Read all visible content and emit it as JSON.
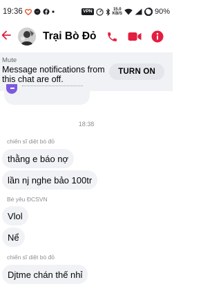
{
  "status_bar": {
    "time": "19:36",
    "vpn_label": "VPN",
    "speed_value": "15.0",
    "speed_unit": "KB/S",
    "battery_percent": "90%",
    "icons": [
      "heart-icon",
      "messenger-icon",
      "facebook-icon",
      "dot-icon",
      "vpn-icon",
      "speed-icon",
      "bluetooth-icon",
      "wifi-icon",
      "signal-icon",
      "battery-icon"
    ]
  },
  "header": {
    "contact_name": "Trại Bò Đỏ",
    "accent_color": "#e41e3f",
    "icons": [
      "back-arrow-icon",
      "phone-icon",
      "video-camera-icon",
      "info-icon"
    ]
  },
  "mute_banner": {
    "title": "Mute",
    "message": "Message notifications from this chat are off.",
    "button_label": "TURN ON"
  },
  "chat": {
    "timestamp": "18:38",
    "groups": [
      {
        "sender": "chiến sĩ diệt bò đỏ",
        "messages": [
          "thằng e báo nợ",
          "lần nj nghe bảo 100tr"
        ]
      },
      {
        "sender": "Bé yêu ĐCSVN",
        "messages": [
          "Vlol",
          "Nể"
        ]
      },
      {
        "sender": "chiến sĩ diệt bò đỏ",
        "messages": [
          "Djtme chán thế nhỉ"
        ]
      }
    ]
  }
}
